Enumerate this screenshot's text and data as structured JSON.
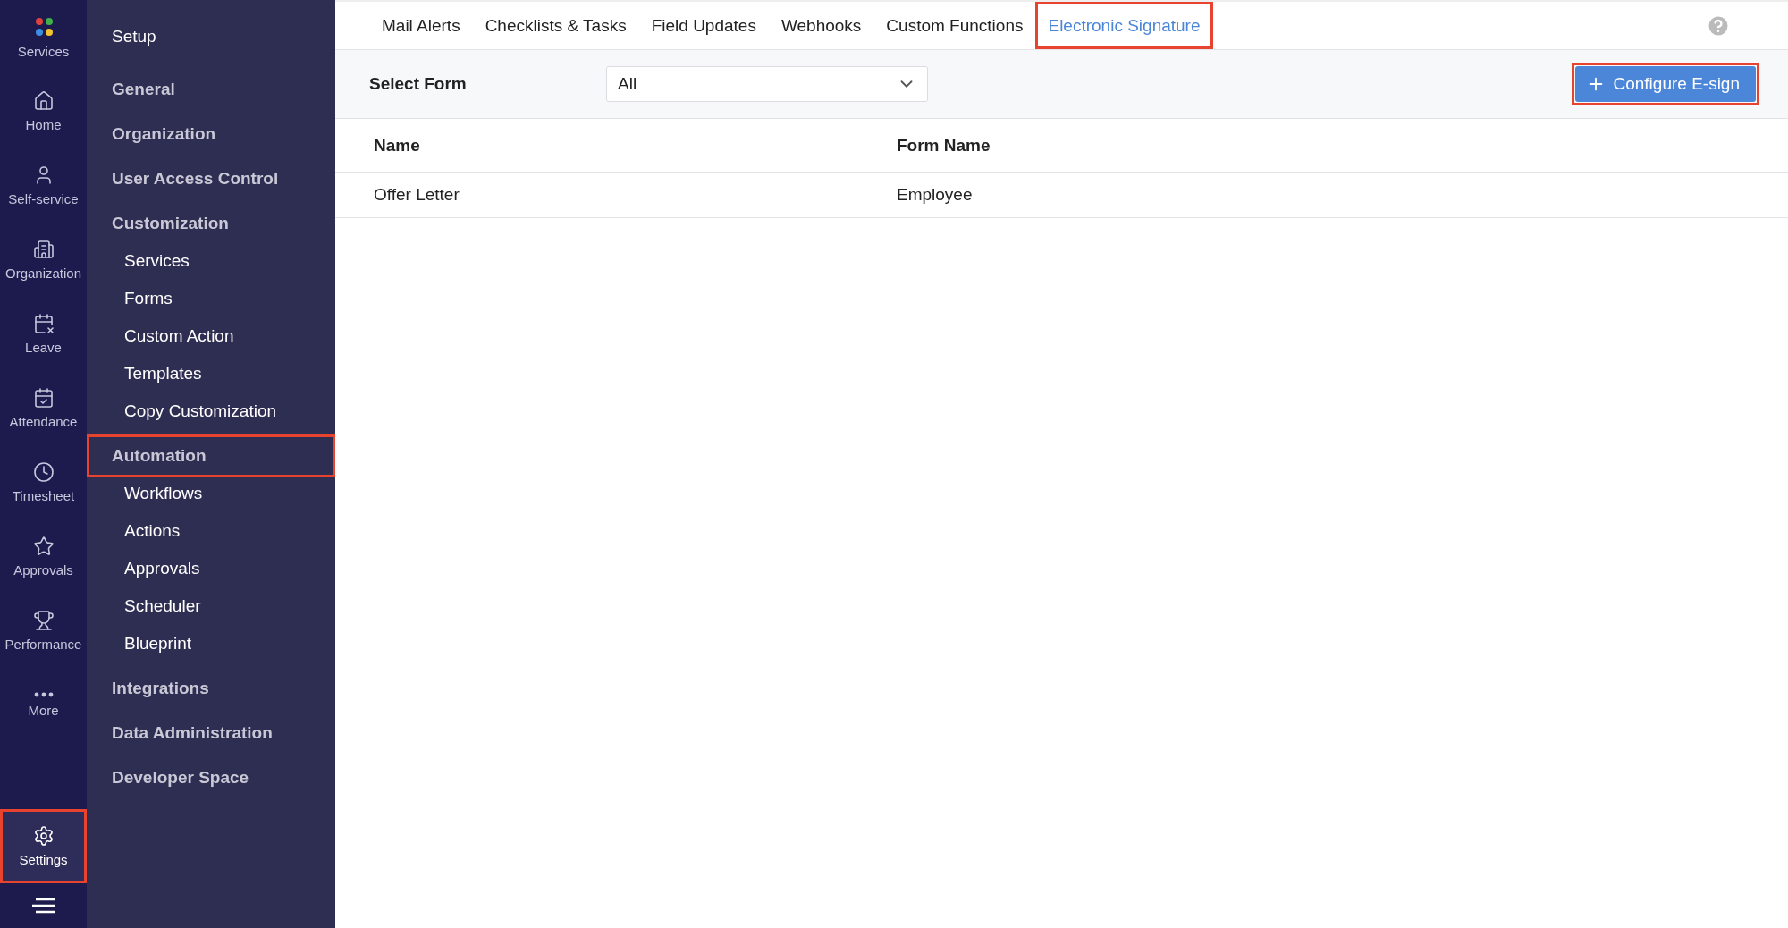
{
  "rail": {
    "items": [
      {
        "label": "Services",
        "selected": false,
        "highlighted": false
      },
      {
        "label": "Home",
        "selected": false,
        "highlighted": false
      },
      {
        "label": "Self-service",
        "selected": false,
        "highlighted": false
      },
      {
        "label": "Organization",
        "selected": false,
        "highlighted": false
      },
      {
        "label": "Leave",
        "selected": false,
        "highlighted": false
      },
      {
        "label": "Attendance",
        "selected": false,
        "highlighted": false
      },
      {
        "label": "Timesheet",
        "selected": false,
        "highlighted": false
      },
      {
        "label": "Approvals",
        "selected": false,
        "highlighted": false
      },
      {
        "label": "Performance",
        "selected": false,
        "highlighted": false
      },
      {
        "label": "More",
        "selected": false,
        "highlighted": false
      },
      {
        "label": "Settings",
        "selected": true,
        "highlighted": true
      }
    ]
  },
  "sidebar": {
    "title": "Setup",
    "items": [
      {
        "label": "General",
        "highlighted": false
      },
      {
        "label": "Organization",
        "highlighted": false
      },
      {
        "label": "User Access Control",
        "highlighted": false
      },
      {
        "label": "Customization",
        "highlighted": false,
        "children": [
          {
            "label": "Services"
          },
          {
            "label": "Forms"
          },
          {
            "label": "Custom Action"
          },
          {
            "label": "Templates"
          },
          {
            "label": "Copy Customization"
          }
        ]
      },
      {
        "label": "Automation",
        "highlighted": true,
        "children": [
          {
            "label": "Workflows"
          },
          {
            "label": "Actions"
          },
          {
            "label": "Approvals"
          },
          {
            "label": "Scheduler"
          },
          {
            "label": "Blueprint"
          }
        ]
      },
      {
        "label": "Integrations",
        "highlighted": false
      },
      {
        "label": "Data Administration",
        "highlighted": false
      },
      {
        "label": "Developer Space",
        "highlighted": false
      }
    ]
  },
  "tabs": [
    {
      "label": "Mail Alerts",
      "selected": false,
      "highlighted": false
    },
    {
      "label": "Checklists & Tasks",
      "selected": false,
      "highlighted": false
    },
    {
      "label": "Field Updates",
      "selected": false,
      "highlighted": false
    },
    {
      "label": "Webhooks",
      "selected": false,
      "highlighted": false
    },
    {
      "label": "Custom Functions",
      "selected": false,
      "highlighted": false
    },
    {
      "label": "Electronic Signature",
      "selected": true,
      "highlighted": true
    }
  ],
  "filter": {
    "label": "Select Form",
    "value": "All"
  },
  "action_button": {
    "label": "Configure E-sign",
    "highlighted": true
  },
  "table": {
    "columns": [
      "Name",
      "Form Name"
    ],
    "rows": [
      [
        "Offer Letter",
        "Employee"
      ]
    ]
  }
}
